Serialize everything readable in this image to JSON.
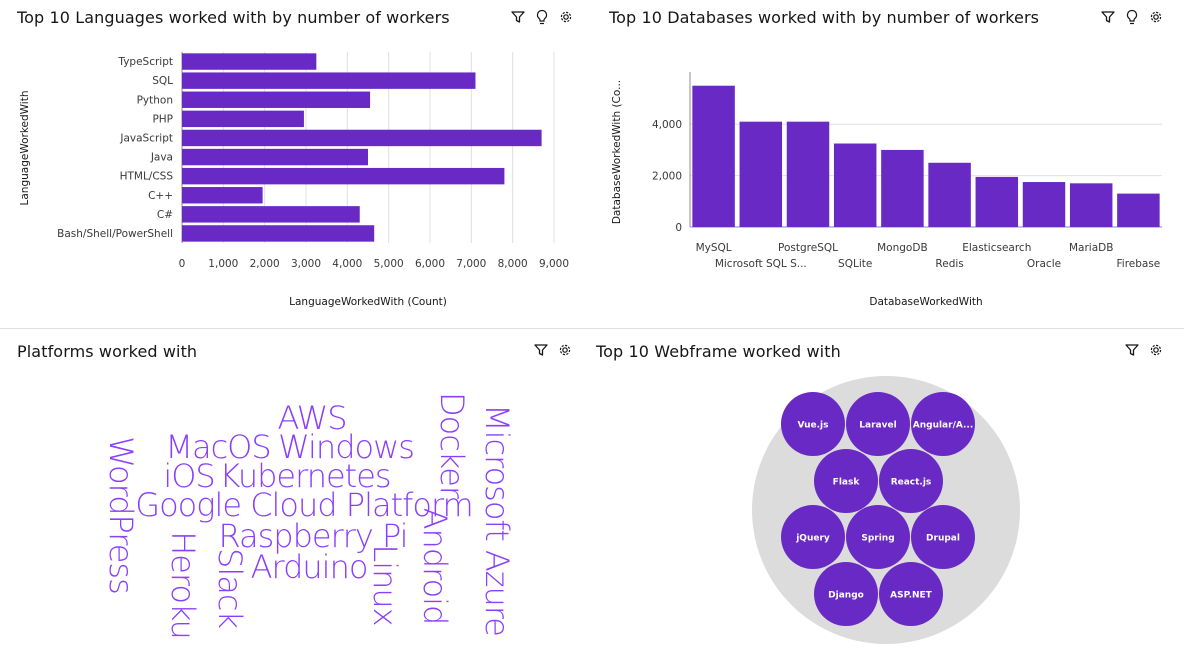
{
  "colors": {
    "bar": "#6929c4",
    "grid": "#e0e0e0",
    "axis": "#8d8d8d",
    "bubble_bg": "#dcdcdc",
    "text": "#161616",
    "label": "#393939"
  },
  "panels": {
    "languages": {
      "title": "Top 10 Languages worked with by number of workers",
      "icons": [
        "filter-icon",
        "lightbulb-icon",
        "settings-icon"
      ]
    },
    "databases": {
      "title": "Top 10 Databases worked with by number of workers",
      "icons": [
        "filter-icon",
        "lightbulb-icon",
        "settings-icon"
      ]
    },
    "platforms": {
      "title": "Platforms worked with",
      "icons": [
        "filter-icon",
        "settings-icon"
      ]
    },
    "webframes": {
      "title": "Top 10 Webframe worked with",
      "icons": [
        "filter-icon",
        "settings-icon"
      ]
    }
  },
  "chart_data": [
    {
      "type": "bar",
      "orientation": "horizontal",
      "categories": [
        "TypeScript",
        "SQL",
        "Python",
        "PHP",
        "JavaScript",
        "Java",
        "HTML/CSS",
        "C++",
        "C#",
        "Bash/Shell/PowerShell"
      ],
      "values": [
        3250,
        7100,
        4550,
        2950,
        8700,
        4500,
        7800,
        1950,
        4300,
        4650
      ],
      "xticks": [
        "0",
        "1,000",
        "2,000",
        "3,000",
        "4,000",
        "5,000",
        "6,000",
        "7,000",
        "8,000",
        "9,000"
      ],
      "xlim": [
        0,
        9000
      ],
      "xlabel": "LanguageWorkedWith (Count)",
      "ylabel": "LanguageWorkedWith"
    },
    {
      "type": "bar",
      "orientation": "vertical",
      "categories": [
        "MySQL",
        "Microsoft SQL S...",
        "PostgreSQL",
        "SQLite",
        "MongoDB",
        "Redis",
        "Elasticsearch",
        "Oracle",
        "MariaDB",
        "Firebase"
      ],
      "values": [
        5500,
        4100,
        4100,
        3250,
        3000,
        2500,
        1950,
        1750,
        1700,
        1300
      ],
      "yticks": [
        "0",
        "2,000",
        "4,000"
      ],
      "ylim": [
        0,
        5800
      ],
      "xlabel": "DatabaseWorkedWith",
      "ylabel": "DatabaseWorkedWith (Co..."
    },
    {
      "type": "wordcloud",
      "words": [
        "AWS",
        "MacOS",
        "Windows",
        "iOS",
        "Kubernetes",
        "Google Cloud Platform",
        "Raspberry Pi",
        "Arduino",
        "WordPress",
        "Heroku",
        "Slack",
        "Linux",
        "Android",
        "Docker",
        "Microsoft Azure"
      ]
    },
    {
      "type": "bubble",
      "items": [
        "Vue.js",
        "Laravel",
        "Angular/A...",
        "Flask",
        "React.js",
        "jQuery",
        "Spring",
        "Drupal",
        "Django",
        "ASP.NET"
      ]
    }
  ]
}
